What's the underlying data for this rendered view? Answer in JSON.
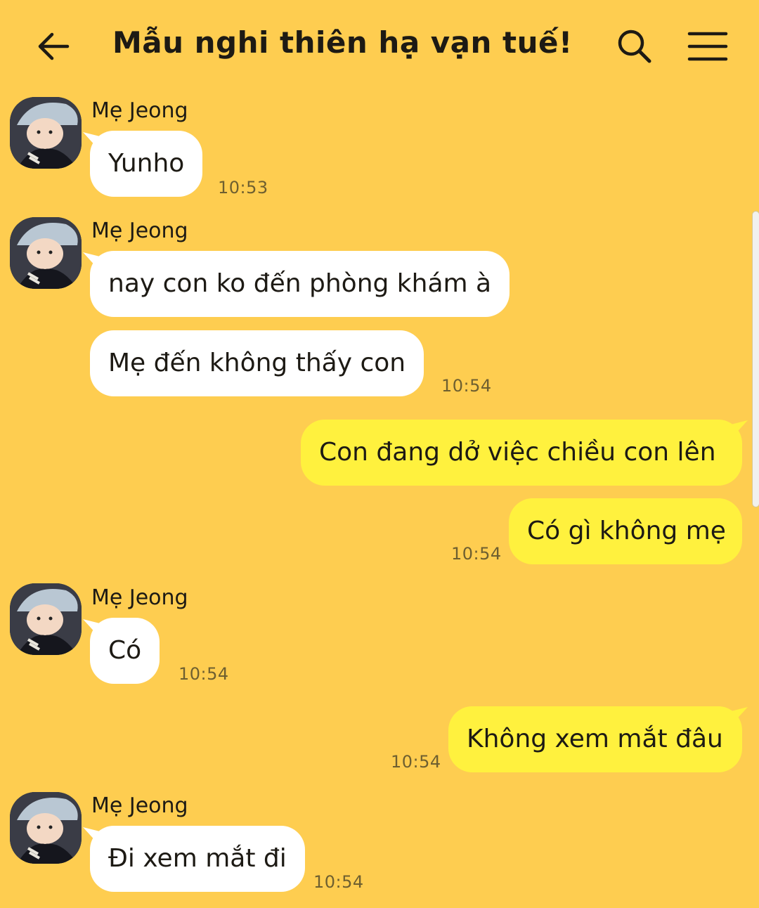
{
  "header": {
    "title": "Mẫu nghi thiên hạ vạn tuế!",
    "back_icon": "arrow-left-icon",
    "search_icon": "search-icon",
    "menu_icon": "hamburger-menu-icon"
  },
  "colors": {
    "background": "#fecd50",
    "incoming_bubble": "#ffffff",
    "outgoing_bubble": "#fff13e"
  },
  "messages": [
    {
      "sender": "Mẹ Jeong",
      "text": "Yunho",
      "time": "10:53"
    },
    {
      "sender": "Mẹ Jeong",
      "text": "nay con ko đến phòng khám à"
    },
    {
      "text": "Mẹ đến không thấy con",
      "time": "10:54"
    },
    {
      "text": "Con đang dở việc chiều con lên"
    },
    {
      "text": "Có gì không mẹ",
      "time": "10:54"
    },
    {
      "sender": "Mẹ Jeong",
      "text": "Có",
      "time": "10:54"
    },
    {
      "text": "Không xem mắt đâu",
      "time": "10:54"
    },
    {
      "sender": "Mẹ Jeong",
      "text": "Đi xem mắt đi",
      "time": "10:54"
    }
  ]
}
